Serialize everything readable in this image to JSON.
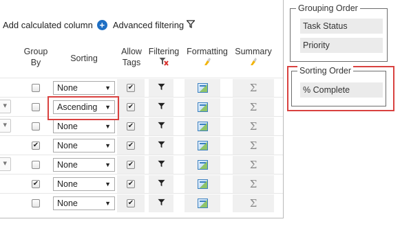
{
  "toolbar": {
    "add_calculated_column": "Add calculated column",
    "advanced_filtering": "Advanced filtering",
    "add_icon": "plus-circle-icon",
    "filter_icon": "funnel-icon"
  },
  "headers": {
    "group_by": "Group By",
    "sorting": "Sorting",
    "allow_tags": "Allow Tags",
    "filtering": "Filtering",
    "formatting": "Formatting",
    "summary": "Summary"
  },
  "rows": [
    {
      "has_dropdown_stub": false,
      "group_checked": false,
      "sorting": "None",
      "tags_checked": true
    },
    {
      "has_dropdown_stub": true,
      "group_checked": false,
      "sorting": "Ascending",
      "tags_checked": true
    },
    {
      "has_dropdown_stub": true,
      "group_checked": false,
      "sorting": "None",
      "tags_checked": true
    },
    {
      "has_dropdown_stub": false,
      "group_checked": true,
      "sorting": "None",
      "tags_checked": true
    },
    {
      "has_dropdown_stub": true,
      "group_checked": false,
      "sorting": "None",
      "tags_checked": true
    },
    {
      "has_dropdown_stub": false,
      "group_checked": true,
      "sorting": "None",
      "tags_checked": true
    },
    {
      "has_dropdown_stub": false,
      "group_checked": false,
      "sorting": "None",
      "tags_checked": true
    }
  ],
  "grouping_order": {
    "title": "Grouping Order",
    "items": [
      "Task Status",
      "Priority"
    ]
  },
  "sorting_order": {
    "title": "Sorting Order",
    "items": [
      "% Complete"
    ]
  },
  "colors": {
    "highlight": "#d9413f",
    "accent": "#1f6fc4"
  }
}
